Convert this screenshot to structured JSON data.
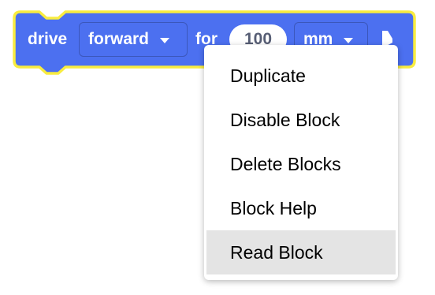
{
  "block": {
    "label_drive": "drive",
    "direction_value": "forward",
    "label_for": "for",
    "distance_value": "100",
    "units_value": "mm",
    "fill_color": "#4c70f0",
    "outline_color": "#f8ec40"
  },
  "context_menu": {
    "items": [
      {
        "label": "Duplicate"
      },
      {
        "label": "Disable Block"
      },
      {
        "label": "Delete Blocks"
      },
      {
        "label": "Block Help"
      },
      {
        "label": "Read Block",
        "highlighted": true
      }
    ],
    "highlight_color": "#e4e4e4"
  }
}
